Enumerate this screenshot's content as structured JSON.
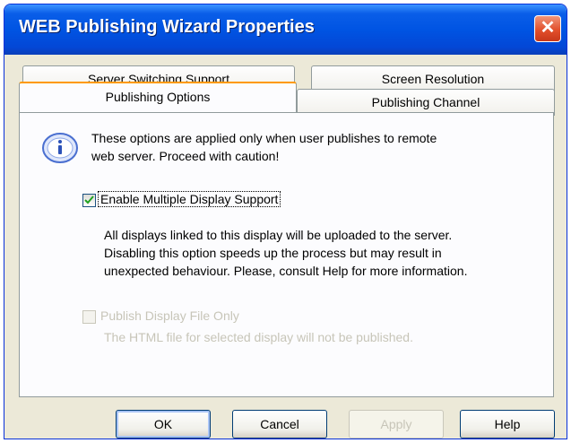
{
  "window": {
    "title": "WEB Publishing Wizard Properties",
    "close_symbol": "✕"
  },
  "tabs": {
    "row_back": [
      {
        "label": "Server Switching Support"
      },
      {
        "label": "Screen Resolution"
      }
    ],
    "row_front": [
      {
        "label": "Publishing Options",
        "active": true
      },
      {
        "label": "Publishing Channel"
      }
    ]
  },
  "info": {
    "icon": "info-icon",
    "line1": "These options are applied only when user publishes to remote",
    "line2": "web server. Proceed with caution!"
  },
  "options": {
    "multi_display": {
      "label": "Enable Multiple Display Support",
      "checked": true,
      "enabled": true,
      "desc_line1": "All displays linked to this display will be uploaded to the server.",
      "desc_line2": "Disabling this option speeds up the process but may result in",
      "desc_line3": "unexpected behaviour. Please, consult Help for more information."
    },
    "publish_only": {
      "label": "Publish Display File Only",
      "checked": false,
      "enabled": false,
      "desc": "The HTML file for selected display will not be published."
    }
  },
  "buttons": {
    "ok": "OK",
    "cancel": "Cancel",
    "apply": "Apply",
    "help": "Help"
  }
}
